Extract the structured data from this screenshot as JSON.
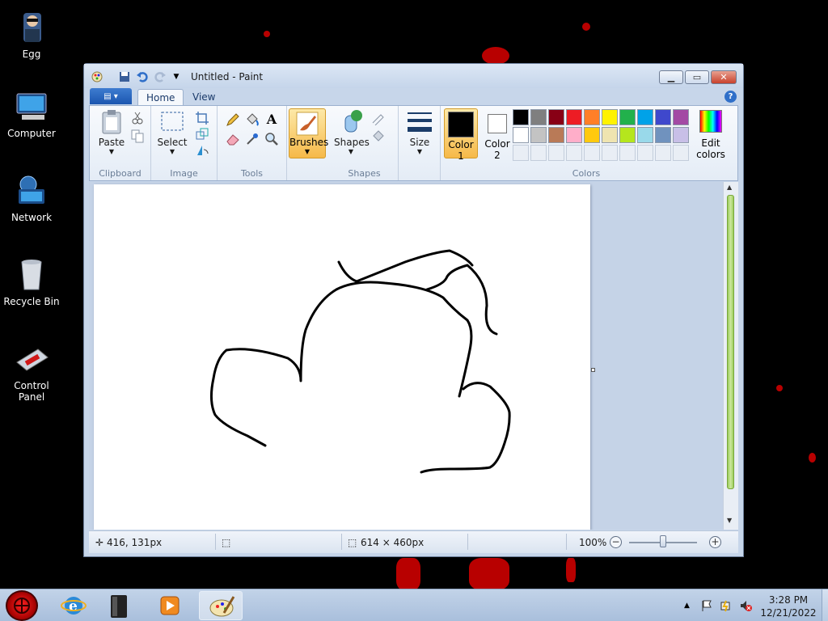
{
  "desktop": {
    "icons": [
      {
        "label": "Egg",
        "icon": "user-avatar-icon"
      },
      {
        "label": "Computer",
        "icon": "computer-icon"
      },
      {
        "label": "Network",
        "icon": "network-icon"
      },
      {
        "label": "Recycle Bin",
        "icon": "recycle-bin-icon"
      },
      {
        "label": "Control Panel",
        "icon": "control-panel-icon"
      }
    ]
  },
  "window": {
    "title": "Untitled - Paint"
  },
  "ribbon": {
    "tabs": [
      {
        "label": "Home"
      },
      {
        "label": "View"
      }
    ],
    "groups": {
      "clipboard": {
        "label": "Clipboard",
        "paste": "Paste"
      },
      "image": {
        "label": "Image",
        "select": "Select"
      },
      "tools": {
        "label": "Tools"
      },
      "brushes": {
        "label": "Brushes"
      },
      "shapes": {
        "label": "Shapes",
        "shapes_btn": "Shapes"
      },
      "size": {
        "label": "Size"
      },
      "colors": {
        "label": "Colors",
        "color1": "Color",
        "color1_num": "1",
        "color2": "Color",
        "color2_num": "2",
        "edit": "Edit",
        "edit2": "colors",
        "color1_value": "#000000",
        "color2_value": "#ffffff",
        "palette_row1": [
          "#000000",
          "#7f7f7f",
          "#880015",
          "#ed1c24",
          "#ff7f27",
          "#fff200",
          "#22b14c",
          "#00a2e8",
          "#3f48cc",
          "#a349a4"
        ],
        "palette_row2": [
          "#ffffff",
          "#c3c3c3",
          "#b97a57",
          "#ffaec9",
          "#ffc90e",
          "#efe4b0",
          "#b5e61d",
          "#99d9ea",
          "#7092be",
          "#c8bfe7"
        ]
      }
    }
  },
  "statusbar": {
    "cursor_pos": "416, 131px",
    "image_size": "614 × 460px",
    "zoom": "100%"
  },
  "taskbar": {
    "time": "3:28 PM",
    "date": "12/21/2022"
  }
}
